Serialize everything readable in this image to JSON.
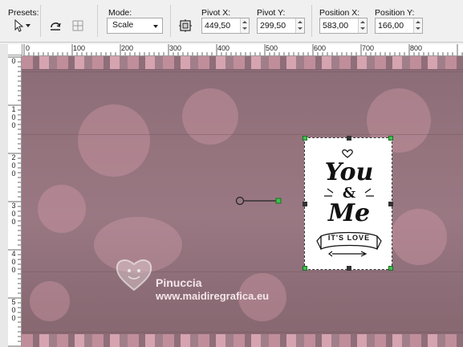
{
  "toolbar": {
    "presets_label": "Presets:",
    "mode_label": "Mode:",
    "mode_value": "Scale",
    "pivot_x_label": "Pivot X:",
    "pivot_x_value": "449,50",
    "pivot_y_label": "Pivot Y:",
    "pivot_y_value": "299,50",
    "position_x_label": "Position X:",
    "position_x_value": "583,00",
    "position_y_label": "Position Y:",
    "position_y_value": "166,00"
  },
  "ruler": {
    "top_ticks": [
      "0",
      "100",
      "200",
      "300",
      "400",
      "500",
      "600",
      "700",
      "800"
    ],
    "left_ticks": [
      "0",
      "100",
      "200",
      "300",
      "400",
      "500"
    ]
  },
  "card": {
    "line1": "You",
    "line2": "&",
    "line3": "Me",
    "banner": "IT'S LOVE"
  },
  "watermark": {
    "name": "Pinuccia",
    "url": "www.maidiregrafica.eu"
  },
  "colors": {
    "canvas_base": "#94737d",
    "handle_green": "#3cc24a",
    "handle_dark": "#333333"
  }
}
